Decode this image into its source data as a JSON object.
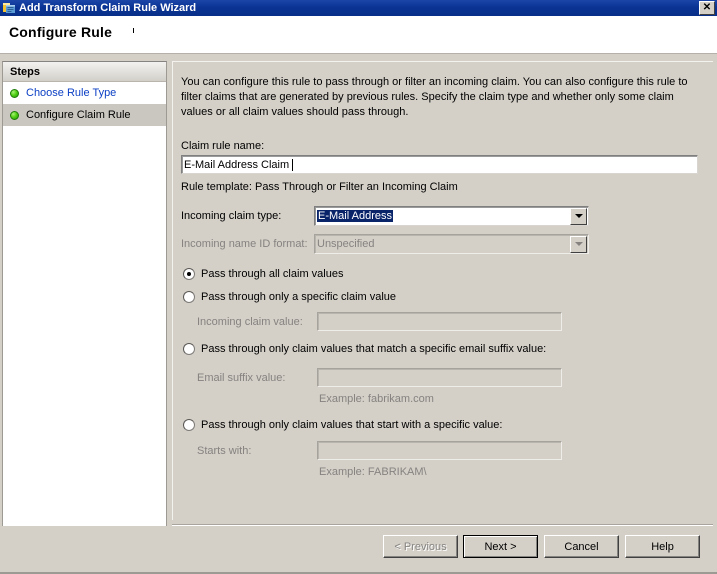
{
  "window": {
    "title": "Add Transform Claim Rule Wizard",
    "icon": "wizard-icon",
    "close_label": "✕"
  },
  "header": {
    "title": "Configure Rule"
  },
  "sidebar": {
    "header": "Steps",
    "items": [
      {
        "label": "Choose Rule Type",
        "state": "link"
      },
      {
        "label": "Configure Claim Rule",
        "state": "current"
      }
    ]
  },
  "content": {
    "intro": "You can configure this rule to pass through or filter an incoming claim. You can also configure this rule to filter claims that are generated by previous rules. Specify the claim type and whether only some claim values or all claim values should pass through.",
    "claim_rule_name_label": "Claim rule name:",
    "claim_rule_name_value": "E-Mail Address Claim",
    "rule_template": "Rule template: Pass Through or Filter an Incoming Claim",
    "incoming_claim_type_label": "Incoming claim type:",
    "incoming_claim_type_value": "E-Mail Address",
    "incoming_name_id_format_label": "Incoming name ID format:",
    "incoming_name_id_format_value": "Unspecified",
    "options": [
      {
        "label": "Pass through all claim values",
        "checked": true,
        "field_label": null,
        "field_value": "",
        "example": null
      },
      {
        "label": "Pass through only a specific claim value",
        "checked": false,
        "field_label": "Incoming claim value:",
        "field_value": "",
        "example": null
      },
      {
        "label": "Pass through only claim values that match a specific email suffix value:",
        "checked": false,
        "field_label": "Email suffix value:",
        "field_value": "",
        "example": "Example: fabrikam.com"
      },
      {
        "label": "Pass through only claim values that start with a specific value:",
        "checked": false,
        "field_label": "Starts with:",
        "field_value": "",
        "example": "Example: FABRIKAM\\"
      }
    ]
  },
  "footer": {
    "previous": "< Previous",
    "next": "Next >",
    "cancel": "Cancel",
    "help": "Help"
  },
  "colors": {
    "titlebar": "#0a3394",
    "dialog": "#d4d0c8",
    "link": "#0b3fc4",
    "selection": "#0a246a",
    "disabled_text": "#858280",
    "step_bullet": "#54d117"
  }
}
